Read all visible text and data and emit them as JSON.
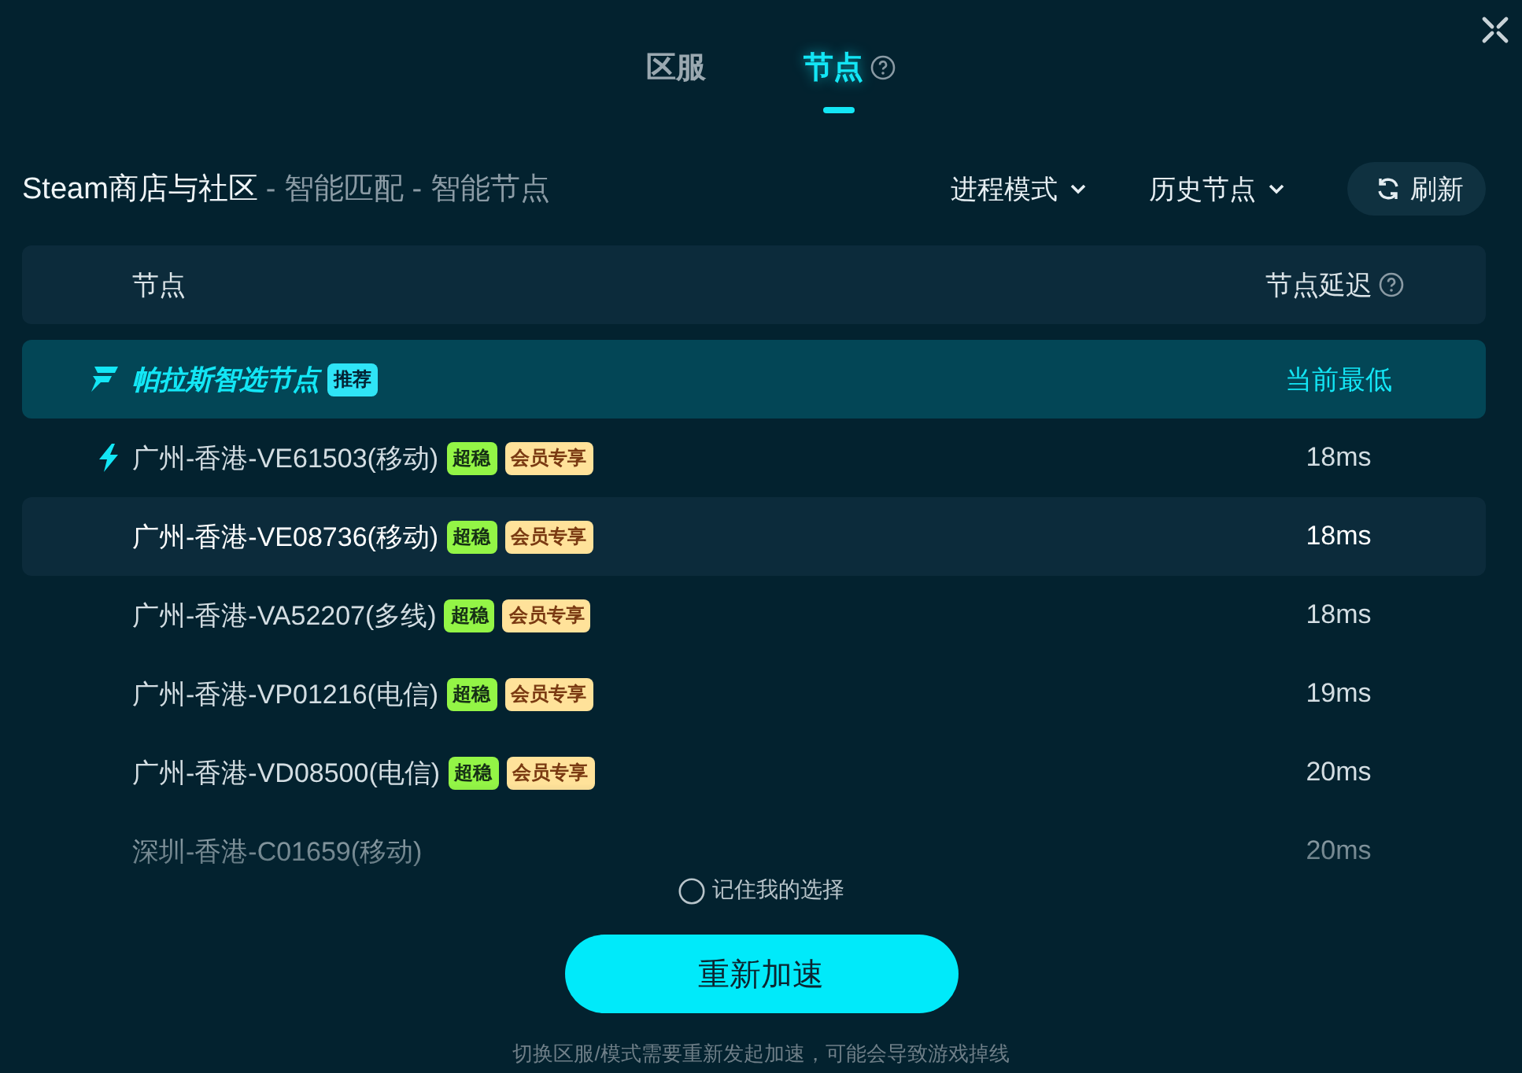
{
  "tabs": [
    {
      "label": "区服",
      "selected": false,
      "help": false
    },
    {
      "label": "节点",
      "selected": true,
      "help": true
    }
  ],
  "breadcrumb": {
    "title": "Steam商店与社区",
    "path": "- 智能匹配 - 智能节点"
  },
  "toolbar": {
    "process_mode": "进程模式",
    "history": "历史节点",
    "refresh": "刷新"
  },
  "table": {
    "columns": [
      "节点",
      "节点延迟"
    ],
    "rows": [
      {
        "kind": "smart",
        "name": "帕拉斯智选节点",
        "tag": "推荐",
        "latency": "当前最低",
        "selected": true,
        "current": false,
        "highlighted": false
      },
      {
        "kind": "node",
        "name": "广州-香港-VE61503(移动)",
        "badges": [
          {
            "kind": "stable",
            "label": "超稳"
          },
          {
            "kind": "vip",
            "label": "会员专享"
          }
        ],
        "latency": "18ms",
        "selected": false,
        "current": true,
        "highlighted": false
      },
      {
        "kind": "node",
        "name": "广州-香港-VE08736(移动)",
        "badges": [
          {
            "kind": "stable",
            "label": "超稳"
          },
          {
            "kind": "vip",
            "label": "会员专享"
          }
        ],
        "latency": "18ms",
        "selected": false,
        "current": false,
        "highlighted": true
      },
      {
        "kind": "node",
        "name": "广州-香港-VA52207(多线)",
        "badges": [
          {
            "kind": "stable",
            "label": "超稳"
          },
          {
            "kind": "vip",
            "label": "会员专享"
          }
        ],
        "latency": "18ms",
        "selected": false,
        "current": false,
        "highlighted": false
      },
      {
        "kind": "node",
        "name": "广州-香港-VP01216(电信)",
        "badges": [
          {
            "kind": "stable",
            "label": "超稳"
          },
          {
            "kind": "vip",
            "label": "会员专享"
          }
        ],
        "latency": "19ms",
        "selected": false,
        "current": false,
        "highlighted": false
      },
      {
        "kind": "node",
        "name": "广州-香港-VD08500(电信)",
        "badges": [
          {
            "kind": "stable",
            "label": "超稳"
          },
          {
            "kind": "vip",
            "label": "会员专享"
          }
        ],
        "latency": "20ms",
        "selected": false,
        "current": false,
        "highlighted": false
      },
      {
        "kind": "node",
        "name": "深圳-香港-C01659(移动)",
        "latency": "20ms",
        "selected": false,
        "current": false,
        "highlighted": false
      }
    ]
  },
  "remember": {
    "label": "记住我的选择",
    "checked": false
  },
  "accelerate_button": "重新加速",
  "footer_note": "切换区服/模式需要重新发起加速，可能会导致游戏掉线"
}
